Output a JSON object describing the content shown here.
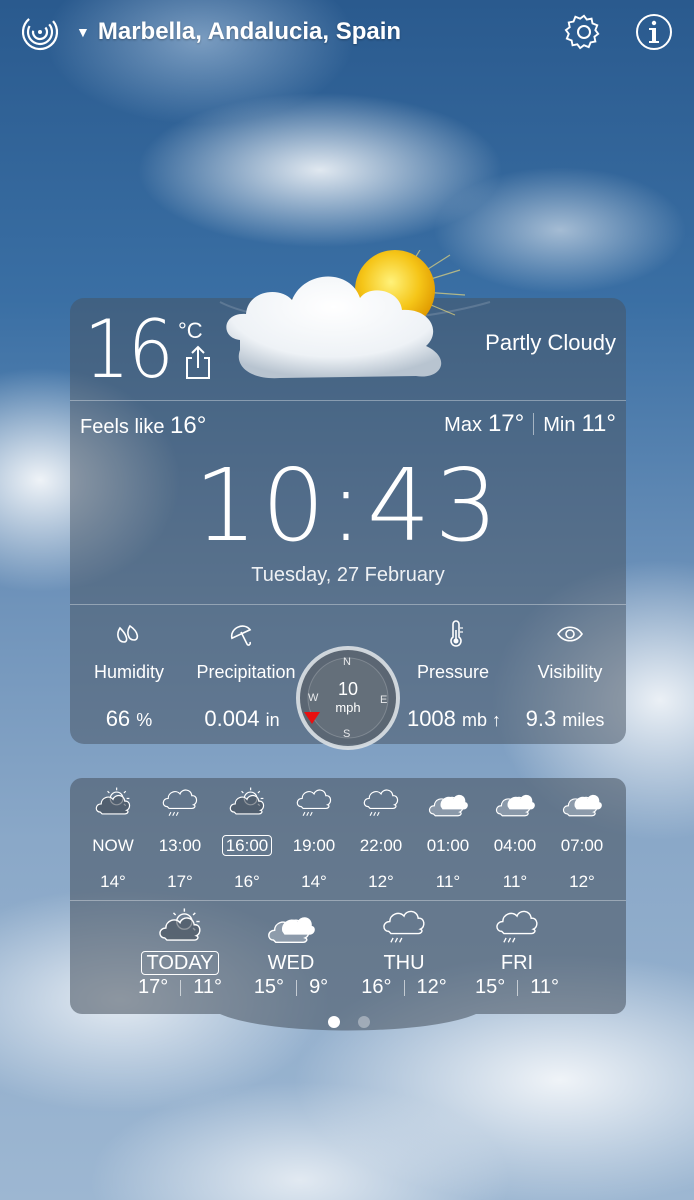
{
  "header": {
    "location": "Marbella, Andalucia, Spain",
    "logo_icon": "radar-logo-icon",
    "settings_icon": "gear-icon",
    "info_icon": "info-icon"
  },
  "current": {
    "temperature": "16",
    "unit": "°C",
    "condition": "Partly Cloudy",
    "feels_like_label": "Feels like",
    "feels_like_value": "16°",
    "max_label": "Max",
    "max_value": "17°",
    "min_label": "Min",
    "min_value": "11°",
    "time": "10:43",
    "date": "Tuesday, 27 February"
  },
  "stats": {
    "humidity": {
      "label": "Humidity",
      "value": "66",
      "unit": "%"
    },
    "precipitation": {
      "label": "Precipitation",
      "value": "0.004",
      "unit": "in"
    },
    "pressure": {
      "label": "Pressure",
      "value": "1008",
      "unit": "mb ↑"
    },
    "visibility": {
      "label": "Visibility",
      "value": "9.3",
      "unit": "miles"
    }
  },
  "wind": {
    "speed": "10",
    "unit": "mph",
    "directions": {
      "n": "N",
      "e": "E",
      "s": "S",
      "w": "W"
    }
  },
  "hourly": [
    {
      "time": "NOW",
      "temp": "14°",
      "icon": "sun-cloud-icon",
      "selected": false
    },
    {
      "time": "13:00",
      "temp": "17°",
      "icon": "cloud-rain-icon",
      "selected": false
    },
    {
      "time": "16:00",
      "temp": "16°",
      "icon": "sun-cloud-icon",
      "selected": true
    },
    {
      "time": "19:00",
      "temp": "14°",
      "icon": "cloud-rain-icon",
      "selected": false
    },
    {
      "time": "22:00",
      "temp": "12°",
      "icon": "cloud-rain-icon",
      "selected": false
    },
    {
      "time": "01:00",
      "temp": "11°",
      "icon": "cloud-icon",
      "selected": false
    },
    {
      "time": "04:00",
      "temp": "11°",
      "icon": "cloud-icon",
      "selected": false
    },
    {
      "time": "07:00",
      "temp": "12°",
      "icon": "cloud-icon",
      "selected": false
    }
  ],
  "daily": [
    {
      "day": "TODAY",
      "max": "17°",
      "min": "11°",
      "icon": "sun-cloud-icon",
      "selected": true
    },
    {
      "day": "WED",
      "max": "15°",
      "min": "9°",
      "icon": "cloud-icon",
      "selected": false
    },
    {
      "day": "THU",
      "max": "16°",
      "min": "12°",
      "icon": "cloud-rain-icon",
      "selected": false
    },
    {
      "day": "FRI",
      "max": "15°",
      "min": "11°",
      "icon": "cloud-rain-icon",
      "selected": false
    }
  ],
  "pager": {
    "pages": 2,
    "active": 0
  }
}
